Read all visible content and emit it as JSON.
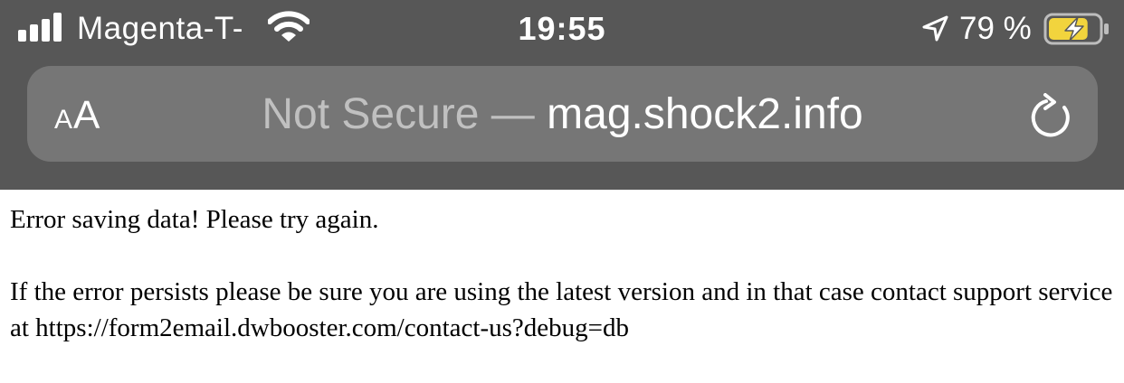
{
  "status_bar": {
    "carrier": "Magenta-T-",
    "time": "19:55",
    "battery_percent": "79 %",
    "signal_bars": 4,
    "battery_level": 0.79,
    "charging": true,
    "icons": [
      "signal-bars-icon",
      "wifi-icon",
      "location-arrow-icon",
      "battery-charging-icon"
    ]
  },
  "address_bar": {
    "text_size_label_small": "A",
    "text_size_label_large": "A",
    "security_label": "Not Secure",
    "separator": "—",
    "host": "mag.shock2.info",
    "reload_icon": "reload-icon"
  },
  "colors": {
    "chrome_background": "#575757",
    "address_bar_background": "#767676",
    "battery_fill": "#f2d43d"
  },
  "page": {
    "error_message": "Error saving data! Please try again.",
    "help_message": "If the error persists please be sure you are using the latest version and in that case contact support service at https://form2email.dwbooster.com/contact-us?debug=db"
  }
}
